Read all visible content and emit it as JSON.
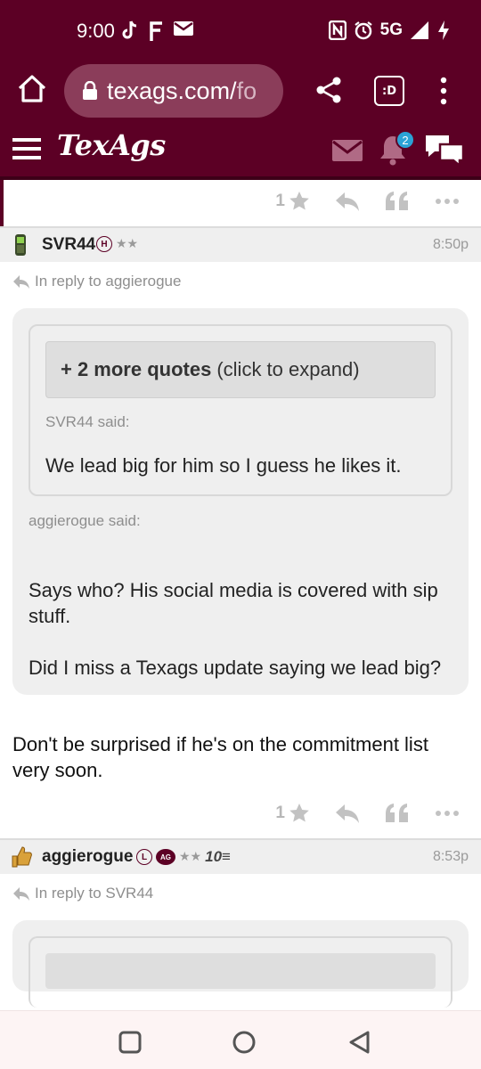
{
  "status": {
    "time": "9:00",
    "network": "5G"
  },
  "browser": {
    "url_main": "texags.com/",
    "url_dim": "fo",
    "tabs_label": ":D"
  },
  "site": {
    "logo": "TexAgs",
    "notif_count": "2"
  },
  "top_action": {
    "count": "1"
  },
  "post1": {
    "username": "SVR44",
    "rank_letter": "H",
    "stars": "★★",
    "time": "8:50p",
    "reply_to": "In reply to aggierogue",
    "expand_bold": "+ 2 more quotes",
    "expand_rest": "(click to expand)",
    "inner_said": "SVR44 said:",
    "inner_text": "We lead big for him so I guess he likes it.",
    "outer_said": "aggierogue said:",
    "outer_text_1": "Says who? His social media is covered with sip stuff.",
    "outer_text_2": "Did I miss a Texags update saying we lead big?",
    "body": "Don't be surprised if he's on the commitment list very soon.",
    "like_count": "1"
  },
  "post2": {
    "username": "aggierogue",
    "rank_letter": "L",
    "rank_badge": "AG",
    "stars": "★★",
    "ten_badge": "10≡",
    "time": "8:53p",
    "reply_to": "In reply to SVR44"
  },
  "colors": {
    "brand": "#5c0025",
    "badge": "#2ba3d6"
  }
}
